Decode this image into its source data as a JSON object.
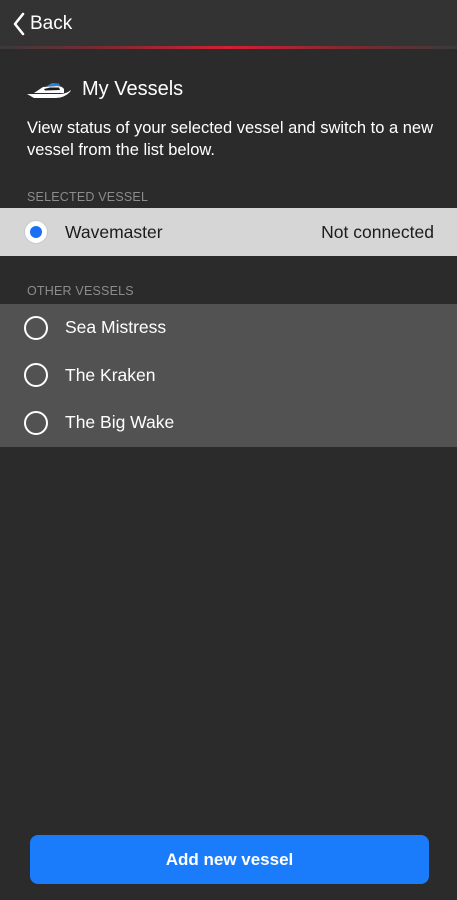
{
  "nav": {
    "back_label": "Back",
    "back_icon": "chevron-left-icon",
    "accent_color": "#d42035"
  },
  "header": {
    "icon": "boat-icon",
    "title": "My Vessels",
    "description": "View status of your selected vessel and switch to a new vessel from the list below."
  },
  "selected_section": {
    "label": "SELECTED VESSEL",
    "vessel": {
      "name": "Wavemaster",
      "status": "Not connected",
      "selected": true
    }
  },
  "other_section": {
    "label": "OTHER VESSELS",
    "vessels": [
      {
        "name": "Sea Mistress",
        "selected": false
      },
      {
        "name": "The Kraken",
        "selected": false
      },
      {
        "name": "The Big Wake",
        "selected": false
      }
    ]
  },
  "footer": {
    "add_button_label": "Add new vessel",
    "button_color": "#1a7cfb"
  }
}
